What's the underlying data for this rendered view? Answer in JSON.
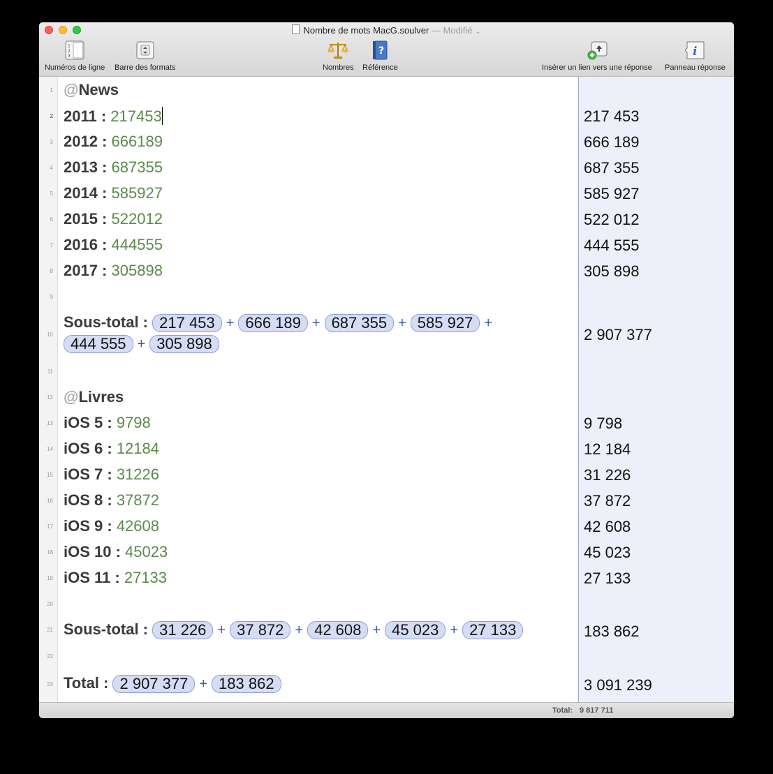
{
  "window": {
    "title": "Nombre de mots MacG.soulver",
    "title_sep": "—",
    "status": "Modifié",
    "status_chevron": "⌄"
  },
  "toolbar": {
    "line_numbers": "Numéros de ligne",
    "format_bar": "Barre des formats",
    "numbers": "Nombres",
    "reference": "Référence",
    "insert_link": "Insérer un lien vers une réponse",
    "answer_panel": "Panneau réponse"
  },
  "lines": {
    "n": [
      "1",
      "2",
      "3",
      "4",
      "5",
      "6",
      "7",
      "8",
      "9",
      "10",
      "11",
      "12",
      "13",
      "14",
      "15",
      "16",
      "17",
      "18",
      "19",
      "20",
      "21",
      "22",
      "23"
    ]
  },
  "doc": {
    "l1": {
      "at": "@",
      "text": "News"
    },
    "l2": {
      "label": "2011 :",
      "num": "217453"
    },
    "l3": {
      "label": "2012 :",
      "num": "666189"
    },
    "l4": {
      "label": "2013 :",
      "num": "687355"
    },
    "l5": {
      "label": "2014 :",
      "num": "585927"
    },
    "l6": {
      "label": "2015 :",
      "num": "522012"
    },
    "l7": {
      "label": "2016 :",
      "num": "444555"
    },
    "l8": {
      "label": "2017 :",
      "num": "305898"
    },
    "l10": {
      "label": "Sous-total :",
      "refs": [
        "217 453",
        "666 189",
        "687 355",
        "585 927",
        "444 555",
        "305 898"
      ]
    },
    "l12": {
      "at": "@",
      "text": "Livres"
    },
    "l13": {
      "label": "iOS 5 :",
      "num": "9798"
    },
    "l14": {
      "label": "iOS 6 :",
      "num": "12184"
    },
    "l15": {
      "label": "iOS 7 :",
      "num": "31226"
    },
    "l16": {
      "label": "iOS 8 :",
      "num": "37872"
    },
    "l17": {
      "label": "iOS 9 :",
      "num": "42608"
    },
    "l18": {
      "label": "iOS 10 :",
      "num": "45023"
    },
    "l19": {
      "label": "iOS 11 :",
      "num": "27133"
    },
    "l21": {
      "label": "Sous-total :",
      "refs": [
        "31 226",
        "37 872",
        "42 608",
        "45 023",
        "27 133"
      ]
    },
    "l23": {
      "label": "Total :",
      "refs": [
        "2 907 377",
        "183 862"
      ]
    },
    "plus": "+"
  },
  "answers": {
    "a2": "217 453",
    "a3": "666 189",
    "a4": "687 355",
    "a5": "585 927",
    "a6": "522 012",
    "a7": "444 555",
    "a8": "305 898",
    "a10": "2 907 377",
    "a13": "9 798",
    "a14": "12 184",
    "a15": "31 226",
    "a16": "37 872",
    "a17": "42 608",
    "a18": "45 023",
    "a19": "27 133",
    "a21": "183 862",
    "a23": "3 091 239"
  },
  "statusbar": {
    "label": "Total:",
    "value": "9 817 711"
  },
  "colors": {
    "number": "#5a8a4a",
    "pill_bg": "#d5ddf5",
    "pill_border": "#8e9fd6",
    "answer_bg": "#edf0fb"
  }
}
